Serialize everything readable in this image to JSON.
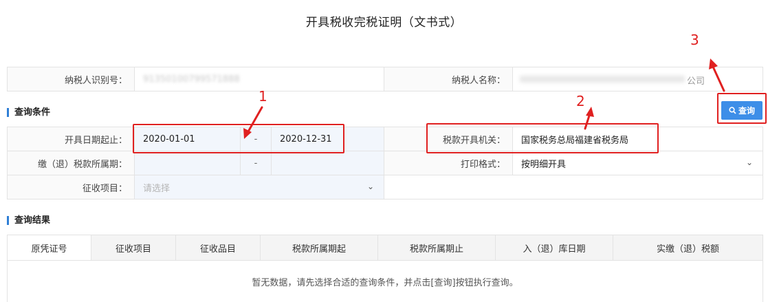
{
  "page": {
    "title": "开具税收完税证明（文书式）"
  },
  "taxpayer": {
    "id_label": "纳税人识别号：",
    "id_value": "91350100799571888",
    "name_label": "纳税人名称：",
    "name_value": "公司"
  },
  "conditions": {
    "section_title": "查询条件",
    "issue_date_label": "开具日期起止：",
    "issue_date_start": "2020-01-01",
    "issue_date_sep": "-",
    "issue_date_end": "2020-12-31",
    "tax_authority_label": "税款开具机关：",
    "tax_authority_value": "国家税务总局福建省税务局",
    "payment_period_label": "缴（退）税款所属期：",
    "payment_period_sep": "-",
    "print_format_label": "打印格式：",
    "print_format_value": "按明细开具",
    "levy_item_label": "征收项目：",
    "levy_item_placeholder": "请选择",
    "query_button": "查询"
  },
  "results": {
    "section_title": "查询结果",
    "columns": [
      "原凭证号",
      "征收项目",
      "征收品目",
      "税款所属期起",
      "税款所属期止",
      "入（退）库日期",
      "实缴（退）税额"
    ],
    "empty_message": "暂无数据，请先选择合适的查询条件，并点击[查询]按钮执行查询。"
  },
  "annotations": {
    "labels": [
      "1",
      "2",
      "3"
    ],
    "color": "#e02020"
  },
  "colors": {
    "accent": "#3d8ee8",
    "section_bar": "#2f7fd6",
    "annotation": "#e02020"
  }
}
